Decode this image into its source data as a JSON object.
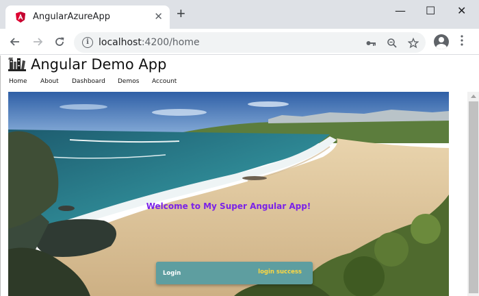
{
  "browser": {
    "tab_title": "AngularAzureApp",
    "url_host": "localhost",
    "url_path": ":4200/home",
    "tab_close_glyph": "✕",
    "new_tab_glyph": "+",
    "window_controls": {
      "minimize": "—",
      "maximize": "☐",
      "close": "✕"
    },
    "icons": {
      "favicon": "angular-icon",
      "back": "back-arrow-icon",
      "forward": "forward-arrow-icon",
      "reload": "reload-icon",
      "info": "info-icon",
      "key": "key-icon",
      "zoom": "zoom-out-icon",
      "bookmark": "star-icon",
      "profile": "profile-icon",
      "menu": "more-vert-icon"
    }
  },
  "app": {
    "title": "Angular Demo App",
    "nav": [
      "Home",
      "About",
      "Dashboard",
      "Demos",
      "Account"
    ],
    "welcome": "Welcome to My Super Angular App!",
    "welcome_color": "#7b22e8"
  },
  "snackbar": {
    "message": "Login",
    "action": "login success",
    "background": "#5e9ea0",
    "action_color": "#ffd740"
  }
}
